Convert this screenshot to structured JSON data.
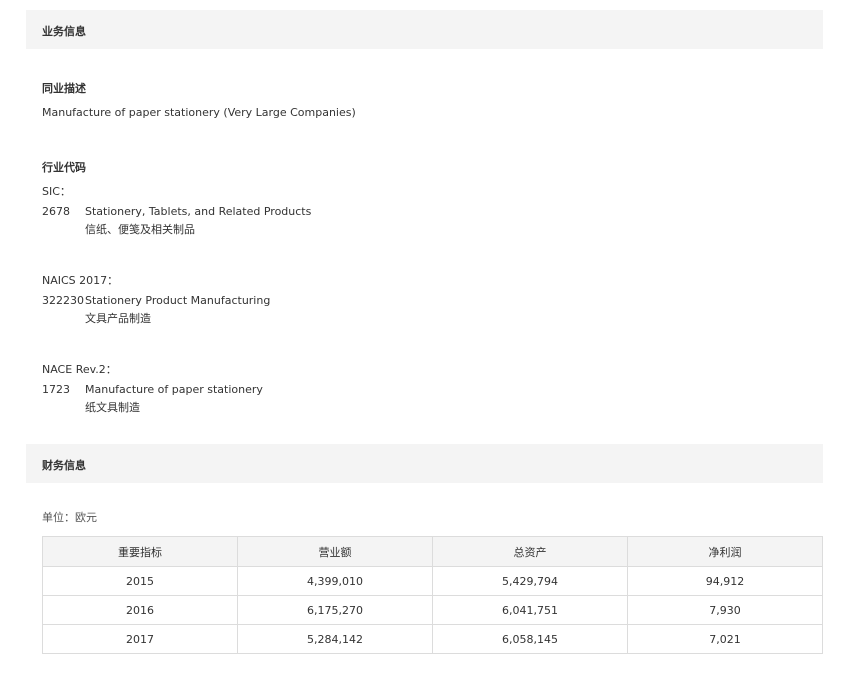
{
  "business": {
    "header": "业务信息",
    "peer_title": "同业描述",
    "peer_desc": "Manufacture of paper stationery (Very Large Companies)",
    "industry_code_title": "行业代码",
    "codes": [
      {
        "system": "SIC：",
        "code": "2678",
        "en": "Stationery, Tablets, and Related Products",
        "zh": "信纸、便笺及相关制品"
      },
      {
        "system": "NAICS 2017：",
        "code": "322230",
        "en": "Stationery Product Manufacturing",
        "zh": "文具产品制造"
      },
      {
        "system": "NACE Rev.2：",
        "code": "1723",
        "en": "Manufacture of paper stationery",
        "zh": "纸文具制造"
      }
    ]
  },
  "finance": {
    "header": "财务信息",
    "unit": "单位：欧元",
    "columns": [
      "重要指标",
      "营业额",
      "总资产",
      "净利润"
    ],
    "rows": [
      [
        "2015",
        "4,399,010",
        "5,429,794",
        "94,912"
      ],
      [
        "2016",
        "6,175,270",
        "6,041,751",
        "7,930"
      ],
      [
        "2017",
        "5,284,142",
        "6,058,145",
        "7,021"
      ]
    ]
  }
}
